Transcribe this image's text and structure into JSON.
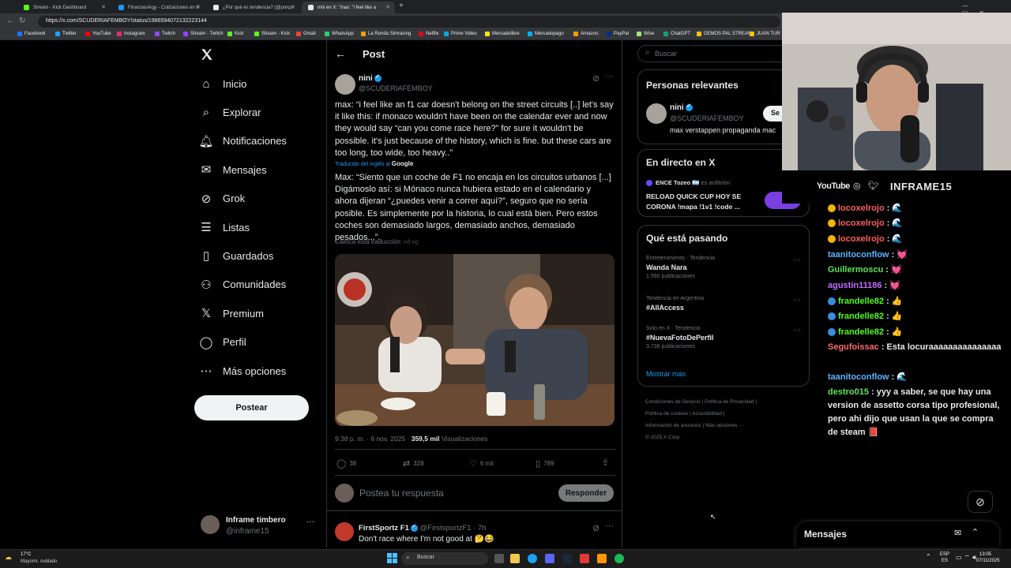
{
  "browser": {
    "tabs": [
      {
        "label": "Stream - Kick Dashboard",
        "color": "#53fc18"
      },
      {
        "label": "FinanzasArgy - Cotizaciones en ti",
        "color": "#1d9bf0"
      },
      {
        "label": "¿Por qué es tendencia? (@porqu",
        "color": "#e7e9ea"
      },
      {
        "label": "nini en X: \"max: \"i feel like a",
        "color": "#e7e9ea"
      }
    ],
    "url": "https://x.com/SCUDERIAFEMBOY/status/1986594072132223144",
    "bookmarks": [
      "Facebook",
      "Twitter",
      "YouTube",
      "Instagram",
      "Twitch",
      "Stream - Twitch",
      "Kick",
      "Stream - Kick",
      "Gmail",
      "WhatsApp",
      "La Ronda Simracing",
      "Netflix",
      "Prime Video",
      "Mercadolibre",
      "Mercadopago",
      "Amazon.",
      "PayPal",
      "Wise",
      "ChatGPT",
      "DEMOS PAL STREAM",
      "JUAN TUR"
    ]
  },
  "nav": {
    "items": [
      "Inicio",
      "Explorar",
      "Notificaciones",
      "Mensajes",
      "Grok",
      "Listas",
      "Guardados",
      "Comunidades",
      "Premium",
      "Perfil",
      "Más opciones"
    ],
    "post_label": "Postear",
    "user_name": "Inframe timbero",
    "user_handle": "@inframe15"
  },
  "header": {
    "title": "Post"
  },
  "tweet": {
    "author": "nini",
    "handle": "@SCUDERIAFEMBOY",
    "text": "max: “i feel like an f1 car doesn't belong on the street circuits [..] let's say it like this: if monaco wouldn't have been on the calendar ever and now they would say “can you come race here?” for sure it wouldn't be possible. it's just because of the history, which is fine. but these cars are too long, too wide, too heavy..”",
    "translated_from": "Traducido del inglés al",
    "translator": "Google",
    "translation": "Max: “Siento que un coche de F1 no encaja en los circuitos urbanos [...] Digámoslo así: si Mónaco nunca hubiera estado en el calendario y ahora dijeran “¿puedes venir a correr aquí?”, seguro que no sería posible. Es simplemente por la historia, lo cual está bien. Pero estos coches son demasiado largos, demasiado anchos, demasiado pesados...”.",
    "rate_translation": "Califica esta traducción:",
    "time": "9:38 p. m. · 6 nov. 2025 ·",
    "views_count": "359,5 mil",
    "views_label": "Visualizaciones",
    "replies": "38",
    "reposts": "328",
    "likes": "6 mil",
    "bookmarks": "789"
  },
  "reply_box": {
    "placeholder": "Postea tu respuesta",
    "button": "Responder"
  },
  "next_reply": {
    "author": "FirstSportz F1",
    "handle": "@FirstsportzF1 · 7h",
    "text": "Don't race where I'm not good at 🤔😂"
  },
  "right": {
    "search_placeholder": "Buscar",
    "relevant_title": "Personas relevantes",
    "relevant_name": "nini",
    "relevant_handle": "@SCUDERIAFEMBOY",
    "relevant_bio": "max verstappen propaganda mac",
    "follow_label": "Se",
    "live_title": "En directo en X",
    "live_host": "ENCE Tozeo 🇦🇷",
    "live_host_role": "es anfitrión",
    "live_text": "RELOAD QUICK CUP HOY SE CORONA !mapa !1v1 !code ...",
    "trends_title": "Qué está pasando",
    "trends": [
      {
        "meta": "Entretenimiento · Tendencia",
        "name": "Wanda Nara",
        "count": "1.560 publicaciones"
      },
      {
        "meta": "Tendencia en Argentina",
        "name": "#AllAccess",
        "count": ""
      },
      {
        "meta": "Solo en X · Tendencia",
        "name": "#NuevaFotoDePerfil",
        "count": "3.738 publicaciones"
      }
    ],
    "show_more": "Mostrar más",
    "footer": [
      "Condiciones de Servicio",
      "Política de Privacidad",
      "Política de cookies",
      "Accesibilidad",
      "Información de anuncios",
      "Más opciones ···",
      "© 2025 X Corp."
    ]
  },
  "stream": {
    "youtube": "YouTube",
    "brand": "INFRAME15"
  },
  "chat": [
    {
      "user": "locoxelrojo",
      "color": "#ff5e5e",
      "msg": ": 🌊"
    },
    {
      "user": "locoxelrojo",
      "color": "#ff5e5e",
      "msg": ": 🌊"
    },
    {
      "user": "locoxelrojo",
      "color": "#ff5e5e",
      "msg": ": 🌊"
    },
    {
      "user": "taanitoconflow",
      "color": "#5ab4ff",
      "msg": ": 💓"
    },
    {
      "user": "Guillermoscu",
      "color": "#5ee35e",
      "msg": ": 💓"
    },
    {
      "user": "agustin11186",
      "color": "#c26bff",
      "msg": ": 💓"
    },
    {
      "user": "frandelle82",
      "color": "#53fc18",
      "msg": ": 👍"
    },
    {
      "user": "frandelle82",
      "color": "#53fc18",
      "msg": ": 👍"
    },
    {
      "user": "frandelle82",
      "color": "#53fc18",
      "msg": ": 👍"
    },
    {
      "user": "Segufoissac",
      "color": "#ff6b6b",
      "msg": ": Esta locuraaaaaaaaaaaaaaa"
    },
    {
      "user": "taanitoconflow",
      "color": "#5ab4ff",
      "msg": ": 🌊"
    },
    {
      "user": "destro015",
      "color": "#5ee35e",
      "msg": ": yyy a saber, se que hay una version de assetto corsa tipo profesional, pero ahi dijo que usan la que se compra de steam 📕"
    }
  ],
  "messages_bar": {
    "title": "Mensajes"
  },
  "taskbar": {
    "weather_temp": "17°C",
    "weather_desc": "Mayorm. nublado",
    "search": "Buscar",
    "lang": "ESP",
    "lang2": "ES",
    "time": "13:05",
    "date": "07/11/2025"
  }
}
